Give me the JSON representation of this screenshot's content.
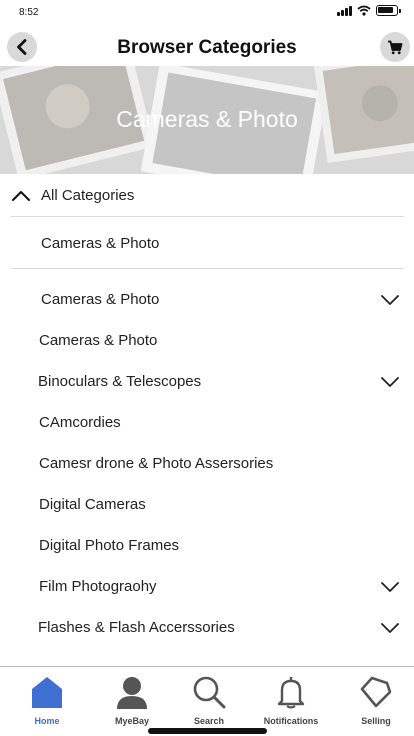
{
  "status_bar": {
    "time": "8:52"
  },
  "header": {
    "title": "Browser Categories",
    "back_icon": "chevron-left-icon",
    "cart_icon": "cart-icon"
  },
  "banner": {
    "title": "Cameras & Photo"
  },
  "all_categories": {
    "label": "All Categories",
    "icon": "chevron-up-icon"
  },
  "selected_category": {
    "label": "Cameras & Photo"
  },
  "categories": [
    {
      "label": "Cameras & Photo",
      "expandable": true
    },
    {
      "label": "Cameras & Photo",
      "expandable": false
    },
    {
      "label": "Binoculars & Telescopes",
      "expandable": true
    },
    {
      "label": "CAmcordies",
      "expandable": false
    },
    {
      "label": "Camesr drone & Photo Assersories",
      "expandable": false
    },
    {
      "label": "Digital Cameras",
      "expandable": false
    },
    {
      "label": "Digital Photo Frames",
      "expandable": false
    },
    {
      "label": "Film Photograohy",
      "expandable": true
    },
    {
      "label": "Flashes & Flash Accerssories",
      "expandable": true
    }
  ],
  "tab_bar": {
    "tabs": [
      {
        "label": "Home",
        "icon": "home-icon",
        "active": true
      },
      {
        "label": "MyeBay",
        "icon": "person-icon",
        "active": false
      },
      {
        "label": "Search",
        "icon": "search-icon",
        "active": false
      },
      {
        "label": "Notifications",
        "icon": "bell-icon",
        "active": false
      },
      {
        "label": "Selling",
        "icon": "tag-icon",
        "active": false
      }
    ]
  },
  "colors": {
    "accent": "#3f6fd1",
    "icon_button_bg": "#d9d9d9",
    "tab_icon": "#555555"
  }
}
